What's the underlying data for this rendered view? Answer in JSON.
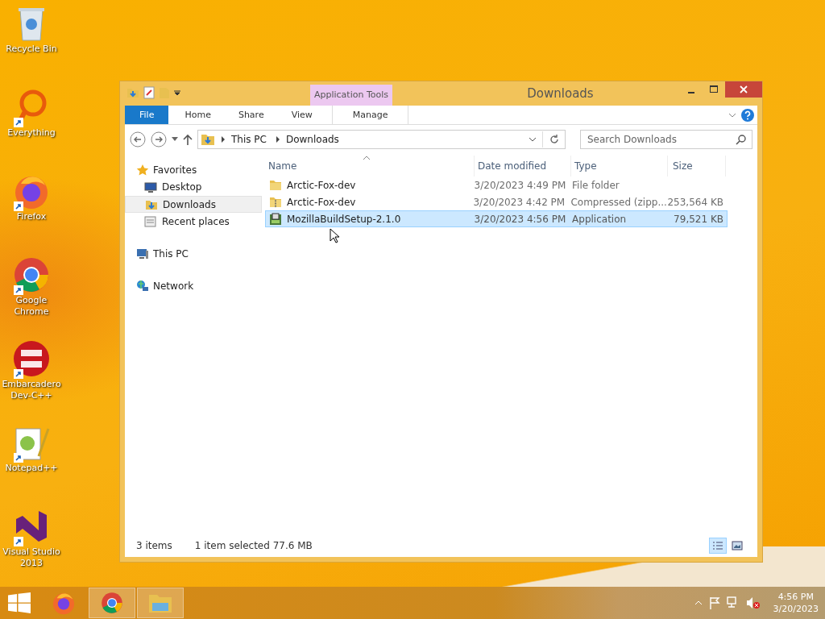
{
  "desktop_icons": [
    {
      "label": "Recycle Bin",
      "kind": "recycle",
      "shortcut": false
    },
    {
      "label": "Everything",
      "kind": "everything",
      "shortcut": true
    },
    {
      "label": "Firefox",
      "kind": "firefox",
      "shortcut": true
    },
    {
      "label": "Google Chrome",
      "kind": "chrome",
      "shortcut": true
    },
    {
      "label": "Embarcadero Dev-C++",
      "kind": "devcpp",
      "shortcut": true
    },
    {
      "label": "Notepad++",
      "kind": "notepad",
      "shortcut": true
    },
    {
      "label": "Visual Studio 2013",
      "kind": "vs",
      "shortcut": true
    }
  ],
  "window": {
    "title": "Downloads",
    "context_group": "Application Tools",
    "ribbon_tabs": [
      {
        "label": "File",
        "kind": "file"
      },
      {
        "label": "Home",
        "kind": "normal"
      },
      {
        "label": "Share",
        "kind": "normal"
      },
      {
        "label": "View",
        "kind": "normal"
      },
      {
        "label": "Manage",
        "kind": "context"
      }
    ],
    "breadcrumbs": [
      "This PC",
      "Downloads"
    ],
    "search": {
      "placeholder": "Search Downloads"
    },
    "nav": [
      {
        "label": "Favorites",
        "kind": "star",
        "children": [
          {
            "label": "Desktop",
            "kind": "desktop",
            "selected": false
          },
          {
            "label": "Downloads",
            "kind": "downloads",
            "selected": true
          },
          {
            "label": "Recent places",
            "kind": "recent",
            "selected": false
          }
        ]
      },
      {
        "label": "This PC",
        "kind": "pc"
      },
      {
        "label": "Network",
        "kind": "network"
      }
    ],
    "columns": [
      "Name",
      "Date modified",
      "Type",
      "Size"
    ],
    "rows": [
      {
        "name": "Arctic-Fox-dev",
        "date": "3/20/2023 4:49 PM",
        "type": "File folder",
        "kind": "folder",
        "selected": false
      },
      {
        "name": "Arctic-Fox-dev",
        "date": "3/20/2023 4:42 PM",
        "type": "Compressed (zipp...",
        "size": "253,564 KB",
        "kind": "zip",
        "selected": false
      },
      {
        "name": "MozillaBuildSetup-2.1.0",
        "date": "3/20/2023 4:56 PM",
        "type": "Application",
        "size": "79,521 KB",
        "kind": "app",
        "selected": true
      }
    ],
    "status": {
      "count": "3 items",
      "selection": "1 item selected  77.6 MB"
    },
    "views": [
      {
        "kind": "details",
        "selected": true
      },
      {
        "kind": "large",
        "selected": false
      }
    ]
  },
  "taskbar": {
    "apps": [
      {
        "kind": "firefox",
        "active": false
      },
      {
        "kind": "chrome",
        "active": true
      },
      {
        "kind": "explorer",
        "active": true
      }
    ],
    "time": "4:56 PM",
    "date": "3/20/2023"
  }
}
